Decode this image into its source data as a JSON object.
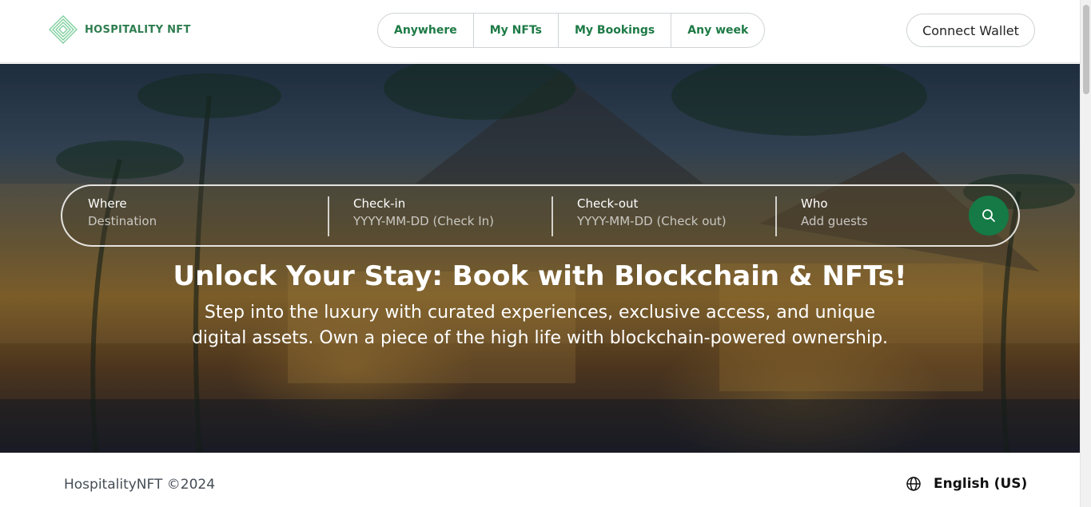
{
  "header": {
    "brand": "HOSPITALITY NFT",
    "nav": [
      {
        "label": "Anywhere"
      },
      {
        "label": "My NFTs"
      },
      {
        "label": "My Bookings"
      },
      {
        "label": "Any week"
      }
    ],
    "wallet_button": "Connect Wallet"
  },
  "search": {
    "where": {
      "label": "Where",
      "placeholder": "Destination"
    },
    "checkin": {
      "label": "Check-in",
      "placeholder": "YYYY-MM-DD (Check In)"
    },
    "checkout": {
      "label": "Check-out",
      "placeholder": "YYYY-MM-DD (Check out)"
    },
    "who": {
      "label": "Who",
      "placeholder": "Add guests"
    },
    "button_icon": "search-icon"
  },
  "hero": {
    "headline": "Unlock Your Stay: Book with Blockchain & NFTs!",
    "subline": "Step into the luxury with curated experiences, exclusive access, and unique digital assets. Own a piece of the high life with blockchain-powered ownership."
  },
  "footer": {
    "copyright": "HospitalityNFT ©2024",
    "language": "English (US)",
    "language_icon": "globe-icon"
  },
  "colors": {
    "brand_green": "#157a45",
    "nav_text": "#1d7a45"
  }
}
